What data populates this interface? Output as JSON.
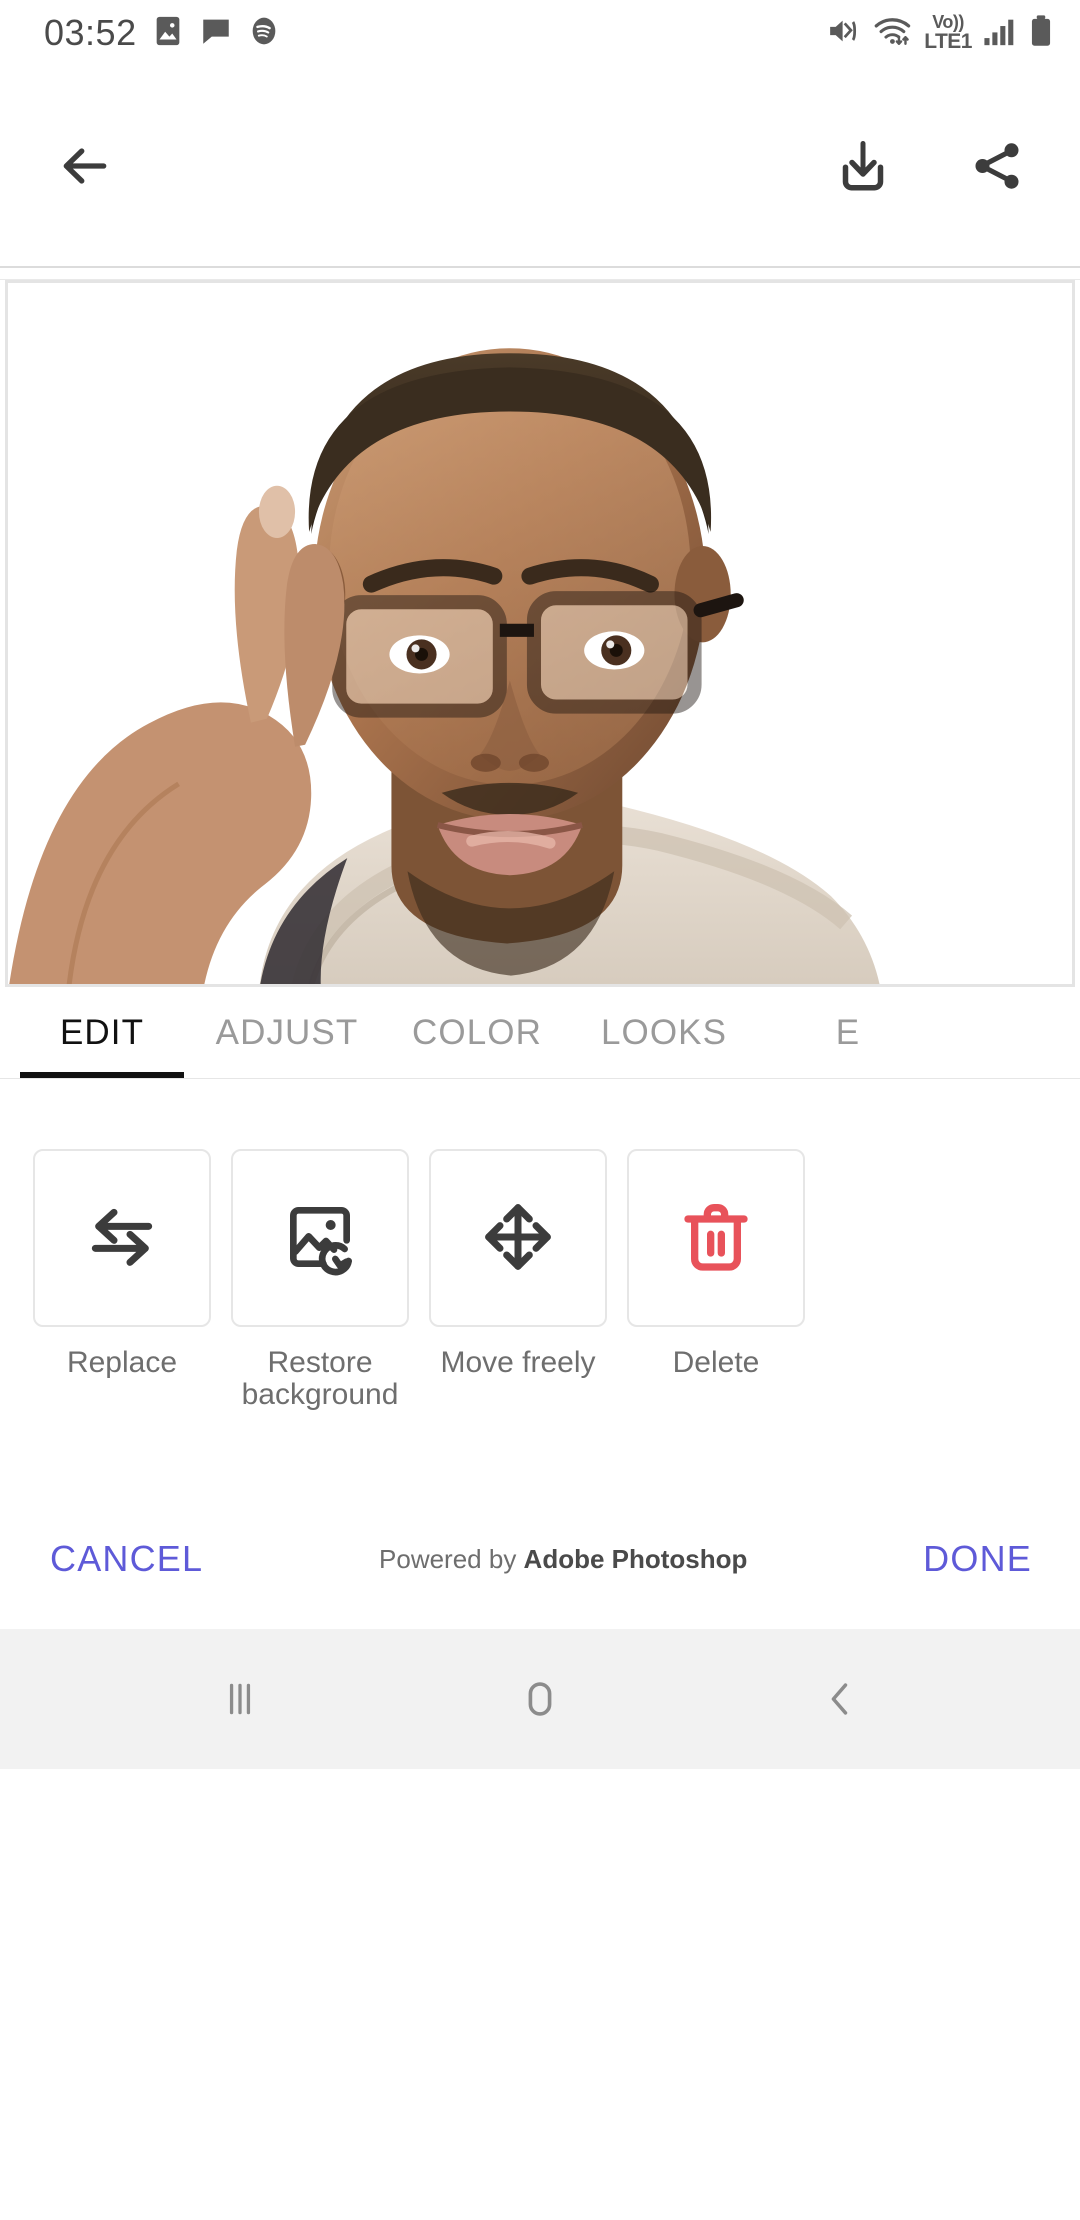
{
  "status_bar": {
    "clock": "03:52",
    "left_icons": [
      "gallery-icon",
      "message-icon",
      "spotify-icon"
    ],
    "right_icons": [
      "mute-vibrate-icon",
      "wifi-icon",
      "volte-icon",
      "signal-icon",
      "battery-icon"
    ],
    "volte_top": "Vo))",
    "volte_bottom": "LTE1"
  },
  "app_bar": {
    "back_icon": "back-arrow-icon",
    "download_icon": "download-icon",
    "share_icon": "share-icon"
  },
  "canvas": {
    "content_description": "Portrait photo of a man wearing black-rimmed glasses and a light beige knit sweater, touching his temple with his hand, on a removed (white) background"
  },
  "tabs": [
    {
      "label": "EDIT",
      "active": true
    },
    {
      "label": "ADJUST",
      "active": false
    },
    {
      "label": "COLOR",
      "active": false
    },
    {
      "label": "LOOKS",
      "active": false
    },
    {
      "label": "E",
      "active": false
    }
  ],
  "actions": [
    {
      "label": "Replace",
      "icon": "swap-arrows-icon",
      "color": "#3c3c3c"
    },
    {
      "label": "Restore\nbackground",
      "icon": "restore-image-icon",
      "color": "#3c3c3c"
    },
    {
      "label": "Move freely",
      "icon": "move-arrows-icon",
      "color": "#3c3c3c"
    },
    {
      "label": "Delete",
      "icon": "trash-icon",
      "color": "#e8525a"
    }
  ],
  "bottom_bar": {
    "cancel_label": "CANCEL",
    "done_label": "DONE",
    "powered_prefix": "Powered by ",
    "powered_brand": "Adobe Photoshop",
    "accent_color": "#5e5ad8"
  },
  "nav_bar": {
    "recents_icon": "recents-icon",
    "home_icon": "home-icon",
    "back_icon": "nav-back-icon"
  }
}
